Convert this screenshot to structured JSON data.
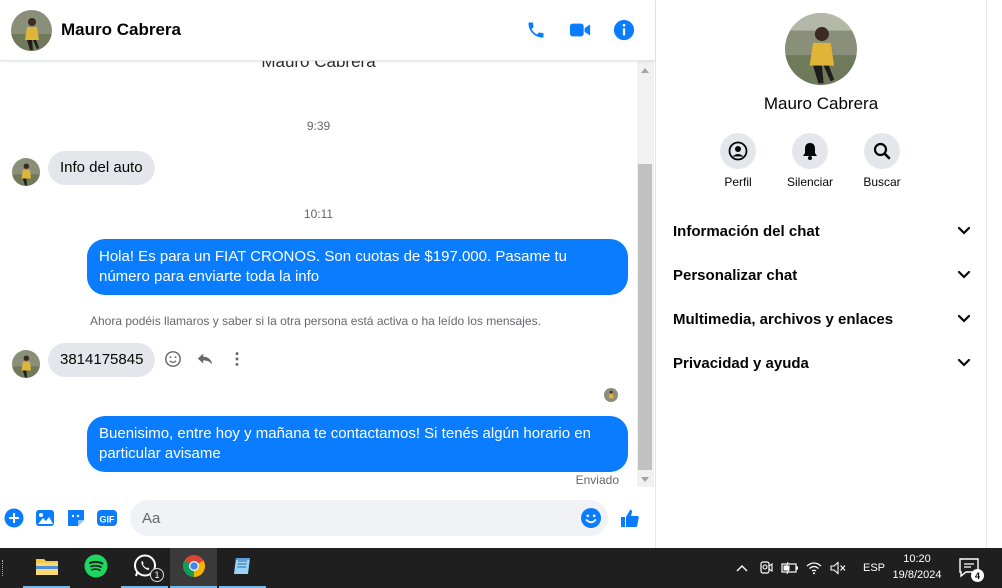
{
  "contact": {
    "name": "Mauro Cabrera"
  },
  "header": {
    "call_icon": "phone-icon",
    "video_icon": "video-camera-icon",
    "info_icon": "info-icon"
  },
  "messages": {
    "ghost_header_name": "Mauro Cabrera",
    "timestamp_1": "9:39",
    "incoming_1": "Info del auto",
    "timestamp_2": "10:11",
    "outgoing_1": "Hola! Es para un FIAT CRONOS. Son cuotas de $197.000. Pasame tu número para enviarte toda la info",
    "system_note": "Ahora podéis llamaros y saber si la otra persona está activa o ha leído los mensajes.",
    "incoming_2": "3814175845",
    "outgoing_2": "Buenisimo, entre hoy y mañana te contactamos! Si tenés algún horario en particular avisame",
    "sent_status": "Enviado"
  },
  "composer": {
    "placeholder": "Aa"
  },
  "info_panel": {
    "name": "Mauro Cabrera",
    "actions": [
      {
        "label": "Perfil",
        "icon": "profile-icon"
      },
      {
        "label": "Silenciar",
        "icon": "bell-icon"
      },
      {
        "label": "Buscar",
        "icon": "search-icon"
      }
    ],
    "sections": [
      {
        "label": "Información del chat"
      },
      {
        "label": "Personalizar chat"
      },
      {
        "label": "Multimedia, archivos y enlaces"
      },
      {
        "label": "Privacidad y ayuda"
      }
    ]
  },
  "taskbar": {
    "apps": [
      {
        "name": "file-explorer",
        "badge": ""
      },
      {
        "name": "spotify",
        "badge": ""
      },
      {
        "name": "whatsapp",
        "badge": "1"
      },
      {
        "name": "chrome",
        "badge": ""
      },
      {
        "name": "notepad",
        "badge": ""
      }
    ],
    "language": "ESP",
    "time": "10:20",
    "date": "19/8/2024",
    "notification_count": "4"
  },
  "colors": {
    "accent": "#0a7cff",
    "incoming_bubble": "#e4e6eb",
    "taskbar": "#1f1f1f"
  }
}
